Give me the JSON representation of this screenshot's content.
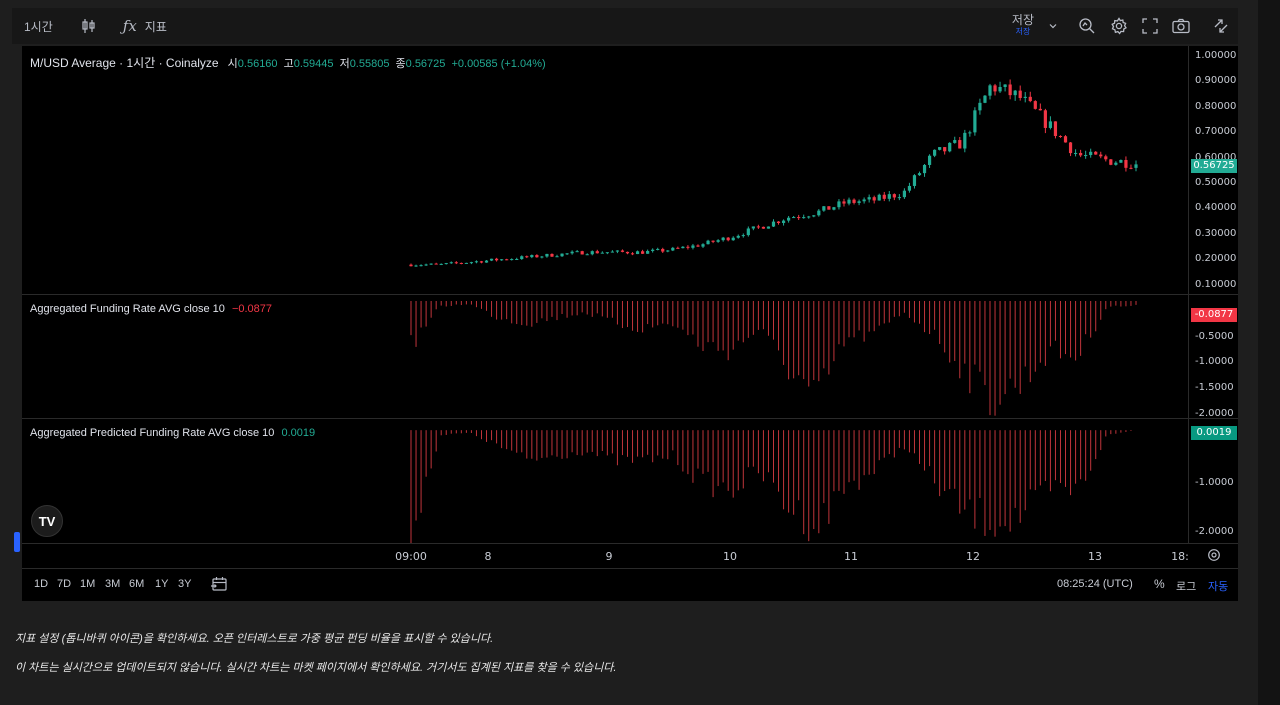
{
  "toolbar": {
    "interval": "1시간",
    "indicators_label": "지표",
    "save_label": "저장",
    "save_sublabel": "저장"
  },
  "main_pane": {
    "title": "M/USD Average · 1시간 · Coinalyze",
    "o_label": "시",
    "o_value": "0.56160",
    "h_label": "고",
    "h_value": "0.59445",
    "l_label": "저",
    "l_value": "0.55805",
    "c_label": "종",
    "c_value": "0.56725",
    "change": "+0.00585 (+1.04%)",
    "last_price": "0.56725",
    "ticks": [
      "1.00000",
      "0.90000",
      "0.80000",
      "0.70000",
      "0.60000",
      "0.50000",
      "0.40000",
      "0.30000",
      "0.20000",
      "0.10000"
    ]
  },
  "funding_pane": {
    "title": "Aggregated Funding Rate AVG close 10",
    "value": "−0.0877",
    "last": "-0.0877",
    "ticks": [
      "-0.5000",
      "-1.0000",
      "-1.5000",
      "-2.0000"
    ]
  },
  "predicted_pane": {
    "title": "Aggregated Predicted Funding Rate AVG close 10",
    "value": "0.0019",
    "last": "0.0019",
    "ticks": [
      "-1.0000",
      "-2.0000"
    ]
  },
  "time_axis": [
    "09:00",
    "8",
    "9",
    "10",
    "11",
    "12",
    "13",
    "18:"
  ],
  "bottom_bar": {
    "ranges": [
      "1D",
      "7D",
      "1M",
      "3M",
      "6M",
      "1Y",
      "3Y"
    ],
    "time": "08:25:24 (UTC)",
    "pct": "%",
    "log": "로그",
    "auto": "자동"
  },
  "footnotes": [
    "지표 설정 (톱니바퀴 아이콘)을 확인하세요. 오픈 인터레스트로 가중 평균 펀딩 비율을 표시할 수 있습니다.",
    "이 차트는 실시간으로 업데이트되지 않습니다. 실시간 차트는 마켓 페이지에서 확인하세요. 거기서도 집계된 지표를 찾을 수 있습니다."
  ],
  "colors": {
    "up": "#22ab94",
    "down": "#f23645",
    "accent": "#2962ff",
    "last_price_bg": "#22ab94",
    "funding_tag_bg": "#f23645",
    "predicted_tag_bg": "#089981"
  },
  "chart_data": [
    {
      "type": "candlestick",
      "title": "M/USD Average · 1시간 · Coinalyze",
      "ylim": [
        0.05,
        1.03
      ],
      "x": [
        "7 09:00",
        "7 15:00",
        "7 21:00",
        "8 03:00",
        "8 09:00",
        "8 15:00",
        "8 21:00",
        "9 03:00",
        "9 09:00",
        "9 15:00",
        "9 21:00",
        "10 03:00",
        "10 09:00",
        "10 15:00",
        "10 21:00",
        "11 03:00",
        "11 09:00",
        "11 15:00",
        "11 21:00",
        "12 03:00",
        "12 09:00",
        "12 15:00",
        "12 21:00",
        "13 03:00",
        "13 09:00",
        "13 15:00"
      ],
      "close": [
        0.16,
        0.16,
        0.17,
        0.18,
        0.19,
        0.2,
        0.21,
        0.21,
        0.21,
        0.22,
        0.24,
        0.27,
        0.31,
        0.35,
        0.37,
        0.41,
        0.42,
        0.45,
        0.6,
        0.65,
        0.88,
        0.83,
        0.72,
        0.6,
        0.58,
        0.567
      ]
    },
    {
      "type": "bar",
      "title": "Aggregated Funding Rate AVG close 10",
      "ylim": [
        -2.0,
        0.0
      ],
      "x": [
        "7 09:00",
        "7 15:00",
        "7 21:00",
        "8 03:00",
        "8 09:00",
        "8 15:00",
        "8 21:00",
        "9 03:00",
        "9 09:00",
        "9 15:00",
        "9 21:00",
        "10 03:00",
        "10 09:00",
        "10 15:00",
        "10 21:00",
        "11 03:00",
        "11 09:00",
        "11 15:00",
        "11 21:00",
        "12 03:00",
        "12 09:00",
        "12 15:00",
        "12 21:00",
        "13 03:00",
        "13 09:00",
        "13 15:00"
      ],
      "values": [
        -0.8,
        -0.1,
        -0.05,
        -0.3,
        -0.4,
        -0.3,
        -0.2,
        -0.4,
        -0.5,
        -0.4,
        -0.8,
        -0.9,
        -0.5,
        -1.2,
        -1.8,
        -0.7,
        -0.6,
        -0.2,
        -0.6,
        -1.2,
        -1.8,
        -1.5,
        -0.9,
        -1.0,
        -0.1,
        -0.09
      ]
    },
    {
      "type": "bar",
      "title": "Aggregated Predicted Funding Rate AVG close 10",
      "ylim": [
        -2.1,
        0.1
      ],
      "x": [
        "7 09:00",
        "7 15:00",
        "7 21:00",
        "8 03:00",
        "8 09:00",
        "8 15:00",
        "8 21:00",
        "9 03:00",
        "9 09:00",
        "9 15:00",
        "9 21:00",
        "10 03:00",
        "10 09:00",
        "10 15:00",
        "10 21:00",
        "11 03:00",
        "11 09:00",
        "11 15:00",
        "11 21:00",
        "12 03:00",
        "12 09:00",
        "12 15:00",
        "12 21:00",
        "13 03:00",
        "13 09:00",
        "13 15:00"
      ],
      "values": [
        -2.0,
        -0.1,
        -0.05,
        -0.3,
        -0.6,
        -0.5,
        -0.4,
        -0.6,
        -0.6,
        -0.5,
        -1.0,
        -1.2,
        -0.8,
        -1.5,
        -1.9,
        -1.1,
        -0.8,
        -0.3,
        -1.0,
        -1.6,
        -1.8,
        -1.7,
        -1.2,
        -1.2,
        -0.1,
        0.0019
      ]
    }
  ]
}
